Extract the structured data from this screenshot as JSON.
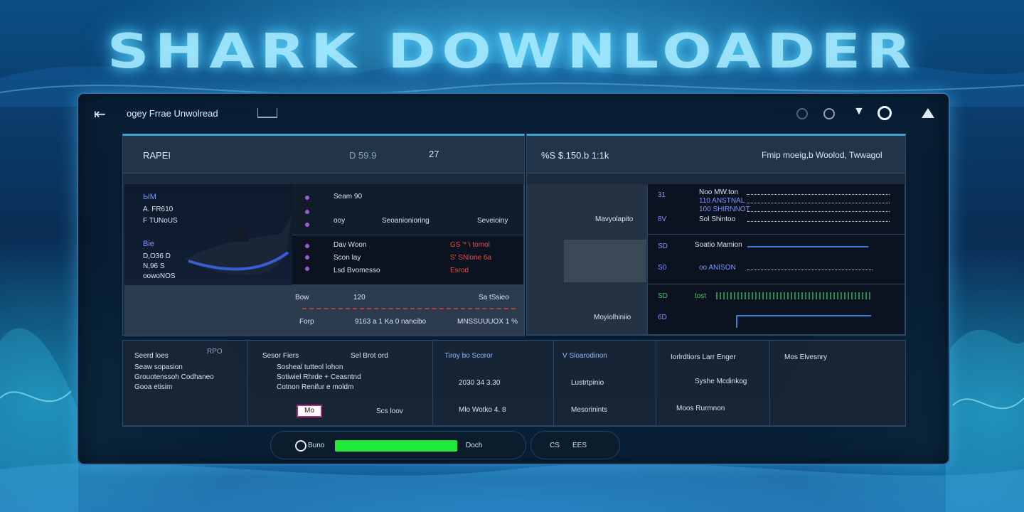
{
  "hero_title": "SHARK DOWNLOADER",
  "window": {
    "title": "ogey Frrae Unwolread",
    "back_icon": "back-arrow-icon",
    "controls": [
      "minimize-icon",
      "maximize-icon",
      "chevron-icon",
      "close-icon",
      "warning-icon"
    ]
  },
  "left_panel": {
    "header_label": "RAPEI",
    "header_value": "D 59.9",
    "header_count": "27",
    "card1_lines": [
      "ЫМ",
      "A. FR610",
      "F TUNoUS"
    ],
    "card2_lines": [
      "Bie",
      "D,O36 D",
      "N,96 S",
      "oowoNOS"
    ],
    "list_top": [
      "Seam 90",
      "ooy"
    ],
    "columns": [
      "Seoanionioring",
      "Seveioiny"
    ],
    "rows": [
      {
        "a": "Dav Woon",
        "b": "GS '* \\ tomol"
      },
      {
        "a": "Scon lay",
        "b": "S' SNlone 6a"
      },
      {
        "a": "Lsd Bvomesso",
        "b": "Esrod"
      }
    ],
    "row_bottom": {
      "label": "Bow",
      "value": "120",
      "right": "Sa tSsieo"
    },
    "footer_left": "Forp",
    "footer_mid": "9163 a 1 Ka 0 nancibo",
    "footer_right": "MNSSUUUOX 1 %"
  },
  "right_panel": {
    "header_left": "%S $.150.b 1:1k",
    "header_right": "Fmip moeig,b Woolod, Twwagol",
    "left_label": "Mavyolapito",
    "left_label2": "Moyiolhiniio",
    "rows": [
      {
        "num": "31",
        "label": "Noo MW.ton"
      },
      {
        "num": "",
        "label": "110 ANSTNAL"
      },
      {
        "num": "",
        "label": "100 SHIRNNOT"
      },
      {
        "num": "8V",
        "label": "Sol Shintoo"
      },
      {
        "num": "SD",
        "label": "Soatio Mamion"
      },
      {
        "num": "S0",
        "label": "oo ANISON"
      },
      {
        "num": "SD",
        "label": "tost"
      },
      {
        "num": "6D",
        "label": ""
      }
    ]
  },
  "bottom_grid": {
    "col1": {
      "head1": "Seerd loes",
      "head2": "RPO",
      "line1": "Seaw sopasion",
      "line2": "Grouotenssoh Codhaneo",
      "line3": "Gooa etisim",
      "thumb": "Mo"
    },
    "col2": {
      "head1": "Sesor Fiers",
      "head2": "Sel Brot ord",
      "line1": "Sosheal tutteol lohon",
      "line2": "Sotiwiel Rhrde + Ceasntnd",
      "line3": "Cotnon Renifur e moldm",
      "bottom": "Scs loov"
    },
    "col3": {
      "head": "Tiroy bo Scoror",
      "v1": "2030 34 3.30",
      "v2": "Mlo Wotko 4. 8"
    },
    "col4": {
      "head": "V Sloarodinon",
      "v1": "Lustrtpinio",
      "v2": "Mesorinints"
    },
    "col5": {
      "head": "Iorlrdtiors Larr Enger",
      "v1": "Syshe Mcdinkog",
      "v2": "Moos Rurmnon"
    },
    "col6": {
      "head": "Mos Elvesnry"
    }
  },
  "footer": {
    "search_label": "Buno",
    "progress": 1.0,
    "progress_label": "Doch",
    "right_icon_label": "CS",
    "right_text": "EES"
  },
  "colors": {
    "accent": "#3aa6d6",
    "progress": "#22e839",
    "highlight_blue": "#7f94ff",
    "alert_red": "#e84a4a"
  }
}
